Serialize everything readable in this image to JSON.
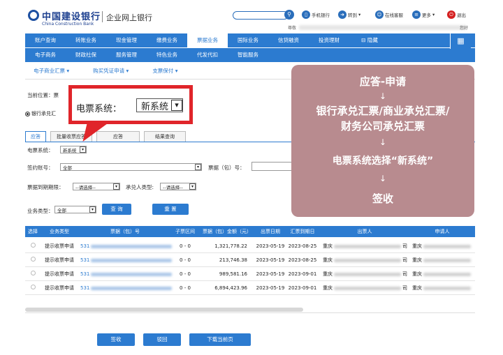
{
  "header": {
    "bank_name_cn": "中国建设银行",
    "bank_name_en": "China Construction Bank",
    "portal": "企业网上银行",
    "top_links": [
      "手机银行",
      "转到",
      "在线客服",
      "更多",
      "退出"
    ],
    "user_prefix": "尊敬",
    "user_suffix": "您好"
  },
  "nav": {
    "row1": [
      "账户查询",
      "转账业务",
      "现金管理",
      "缴费业务",
      "票据业务",
      "国际业务",
      "信贷融资",
      "投资理财",
      "隐藏"
    ],
    "row2": [
      "电子商务",
      "财政社保",
      "服务管理",
      "特色业务",
      "代发代扣",
      "智能服务"
    ],
    "sub": [
      "电子商业汇票",
      "购买凭证申请",
      "支票保付"
    ]
  },
  "page": {
    "location_label": "当前位置：票",
    "bill_type_radio": "银行承兑汇",
    "tabs": [
      "应答",
      "批量收票应答",
      "应答",
      "结果查询"
    ],
    "fields": {
      "system_label": "电票系统：",
      "system_value": "新系统",
      "account_label": "签约账号：",
      "account_value": "全部",
      "bill_no_label": "票据（包）号：",
      "due_date_label": "票据到期期限：",
      "due_date_value": "--请选择--",
      "acceptor_label": "承兑人类型:",
      "acceptor_value": "--请选择--",
      "biz_type_label": "业务类型：",
      "biz_type_value": "全部"
    },
    "query_button": "查 询",
    "reset_button": "重 置"
  },
  "table": {
    "headers": [
      "选择",
      "业务类型",
      "票据（包）号",
      "子票区间",
      "票据（包）金额（元）",
      "出票日期",
      "汇票到期日",
      "出票人",
      "申请人"
    ],
    "rows": [
      {
        "type": "提示收票申请",
        "no_prefix": "531",
        "range": "0 - 0",
        "amount": "1,321,778.22",
        "issue": "2023-05-19",
        "due": "2023-08-25",
        "drawer_prefix": "重庆",
        "drawer_suffix": "司",
        "applicant_prefix": "重庆"
      },
      {
        "type": "提示收票申请",
        "no_prefix": "531",
        "range": "0 - 0",
        "amount": "213,746.38",
        "issue": "2023-05-19",
        "due": "2023-08-25",
        "drawer_prefix": "重庆",
        "drawer_suffix": "司",
        "applicant_prefix": "重庆"
      },
      {
        "type": "提示收票申请",
        "no_prefix": "531",
        "range": "0 - 0",
        "amount": "989,581.16",
        "issue": "2023-05-19",
        "due": "2023-09-01",
        "drawer_prefix": "重庆",
        "drawer_suffix": "司",
        "applicant_prefix": "重庆"
      },
      {
        "type": "提示收票申请",
        "no_prefix": "531",
        "range": "0 - 0",
        "amount": "6,894,423.96",
        "issue": "2023-05-19",
        "due": "2023-09-01",
        "drawer_prefix": "重庆",
        "drawer_suffix": "司",
        "applicant_prefix": "重庆"
      }
    ]
  },
  "bottom_buttons": [
    "签收",
    "驳回",
    "下载当前页"
  ],
  "callout": {
    "label": "电票系统：",
    "value": "新系统"
  },
  "flow": {
    "steps": [
      "应答-申请",
      "银行承兑汇票/商业承兑汇票/",
      "财务公司承兑汇票",
      "电票系统选择“新系统”",
      "签收"
    ],
    "arrow": "↓"
  },
  "colors": {
    "nav_blue": "#2c7bd0",
    "callout_red": "#e0252a",
    "flow_bg": "#b88b8f"
  }
}
